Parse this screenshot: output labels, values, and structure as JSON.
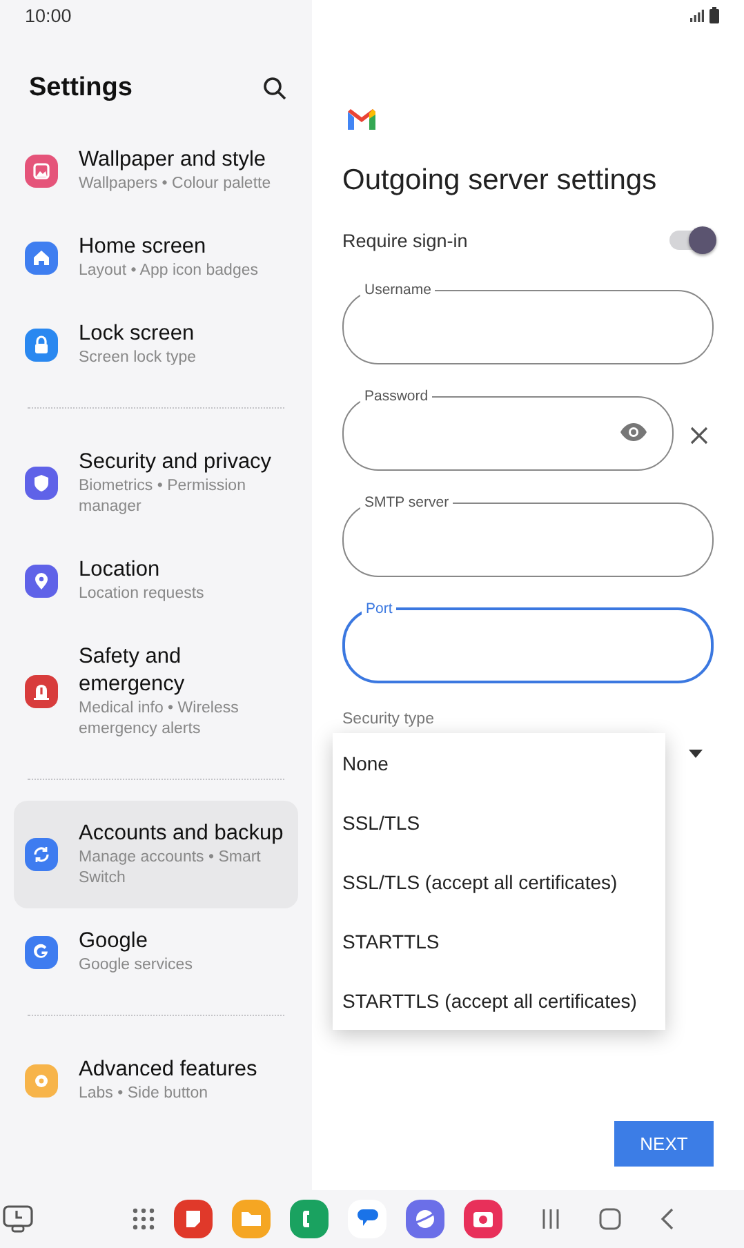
{
  "status_bar": {
    "time": "10:00"
  },
  "sidebar": {
    "title": "Settings",
    "groups": [
      {
        "items": [
          {
            "title": "Wallpaper and style",
            "subtitle": "Wallpapers • Colour palette",
            "kind": "wallpaper",
            "color": "#e5547a",
            "selected": false
          },
          {
            "title": "Home screen",
            "subtitle": "Layout • App icon badges",
            "kind": "home",
            "color": "#3f7ef0",
            "selected": false
          },
          {
            "title": "Lock screen",
            "subtitle": "Screen lock type",
            "kind": "lock",
            "color": "#2a88f0",
            "selected": false
          }
        ]
      },
      {
        "items": [
          {
            "title": "Security and privacy",
            "subtitle": "Biometrics • Permission manager",
            "kind": "shield",
            "color": "#5f62e8",
            "selected": false
          },
          {
            "title": "Location",
            "subtitle": "Location requests",
            "kind": "location",
            "color": "#5f62e8",
            "selected": false
          },
          {
            "title": "Safety and emergency",
            "subtitle": "Medical info • Wireless emergency alerts",
            "kind": "alert",
            "color": "#d83c3c",
            "selected": false
          }
        ]
      },
      {
        "items": [
          {
            "title": "Accounts and backup",
            "subtitle": "Manage accounts • Smart Switch",
            "kind": "sync",
            "color": "#3e7cf0",
            "selected": true
          },
          {
            "title": "Google",
            "subtitle": "Google services",
            "kind": "google",
            "color": "#3e7cf0",
            "selected": false
          }
        ]
      },
      {
        "items": [
          {
            "title": "Advanced features",
            "subtitle": "Labs • Side button",
            "kind": "advanced",
            "color": "#f7b44a",
            "selected": false
          }
        ]
      }
    ]
  },
  "form": {
    "title": "Outgoing server settings",
    "require_sign_in": {
      "label": "Require sign-in",
      "on": true
    },
    "fields": [
      {
        "label": "Username",
        "kind": "text",
        "focused": false
      },
      {
        "label": "Password",
        "kind": "password",
        "focused": false
      },
      {
        "label": "SMTP server",
        "kind": "text",
        "focused": false
      },
      {
        "label": "Port",
        "kind": "text",
        "focused": true
      }
    ],
    "security_type": {
      "label": "Security type",
      "options": [
        "None",
        "SSL/TLS",
        "SSL/TLS (accept all certificates)",
        "STARTTLS",
        "STARTTLS (accept all certificates)"
      ]
    },
    "next_button": "NEXT"
  }
}
